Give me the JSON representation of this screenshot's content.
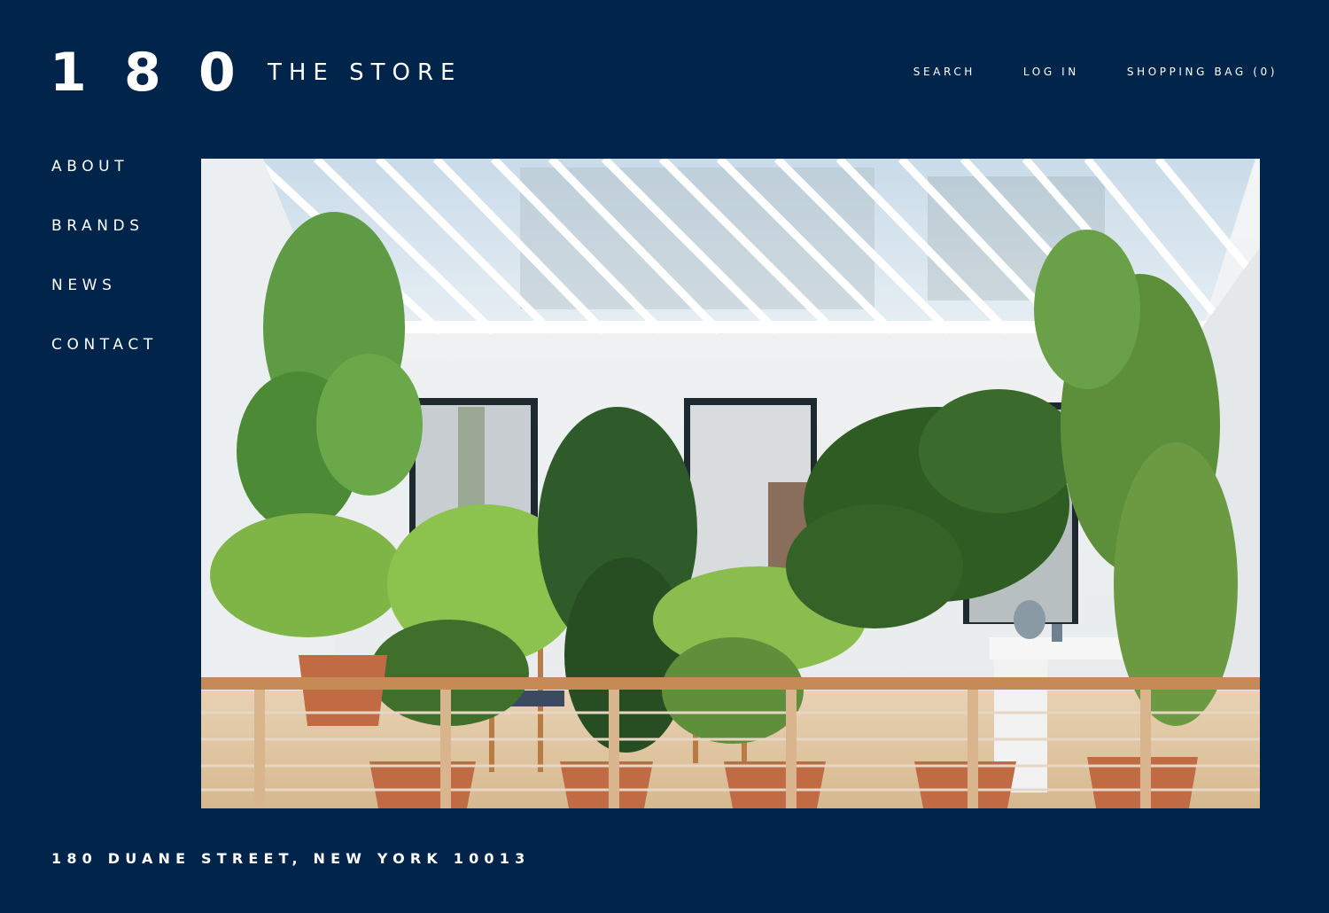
{
  "brand": {
    "digits": [
      "1",
      "8",
      "0"
    ],
    "name": "THE STORE"
  },
  "header_nav": {
    "search": "SEARCH",
    "login": "LOG IN",
    "bag": "SHOPPING BAG (0)"
  },
  "sidebar": {
    "items": [
      {
        "label": "ABOUT"
      },
      {
        "label": "BRANDS"
      },
      {
        "label": "NEWS"
      },
      {
        "label": "CONTACT"
      }
    ]
  },
  "footer": {
    "address": "180 DUANE STREET, NEW YORK 10013"
  },
  "colors": {
    "background": "#01244b",
    "text": "#ffffff"
  }
}
